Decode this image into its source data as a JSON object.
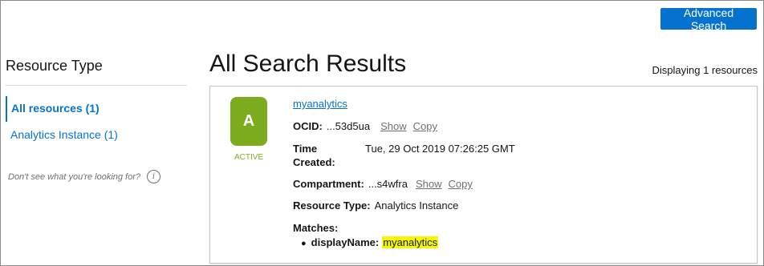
{
  "toolbar": {
    "advanced_search_label": "Advanced Search"
  },
  "sidebar": {
    "title": "Resource Type",
    "items": [
      {
        "label": "All resources (1)",
        "active": true
      },
      {
        "label": "Analytics Instance (1)",
        "active": false
      }
    ],
    "hint": "Don't see what you're looking for?",
    "hint_icon": "info-icon"
  },
  "main": {
    "title": "All Search Results",
    "count_text": "Displaying 1 resources"
  },
  "result": {
    "badge_letter": "A",
    "badge_color": "#7cac1e",
    "status": "ACTIVE",
    "name": "myanalytics",
    "ocid_label": "OCID:",
    "ocid_value": "...53d5ua",
    "show_label": "Show",
    "copy_label": "Copy",
    "time_created_label_1": "Time",
    "time_created_label_2": "Created:",
    "time_created_value": "Tue, 29 Oct 2019 07:26:25 GMT",
    "compartment_label": "Compartment:",
    "compartment_value": "...s4wfra",
    "resource_type_label": "Resource Type:",
    "resource_type_value": "Analytics Instance",
    "matches_label": "Matches:",
    "match_key": "displayName:",
    "match_value": "myanalytics"
  },
  "colors": {
    "accent": "#0572ce",
    "active_green": "#7cac1e",
    "highlight": "#f7f700"
  }
}
